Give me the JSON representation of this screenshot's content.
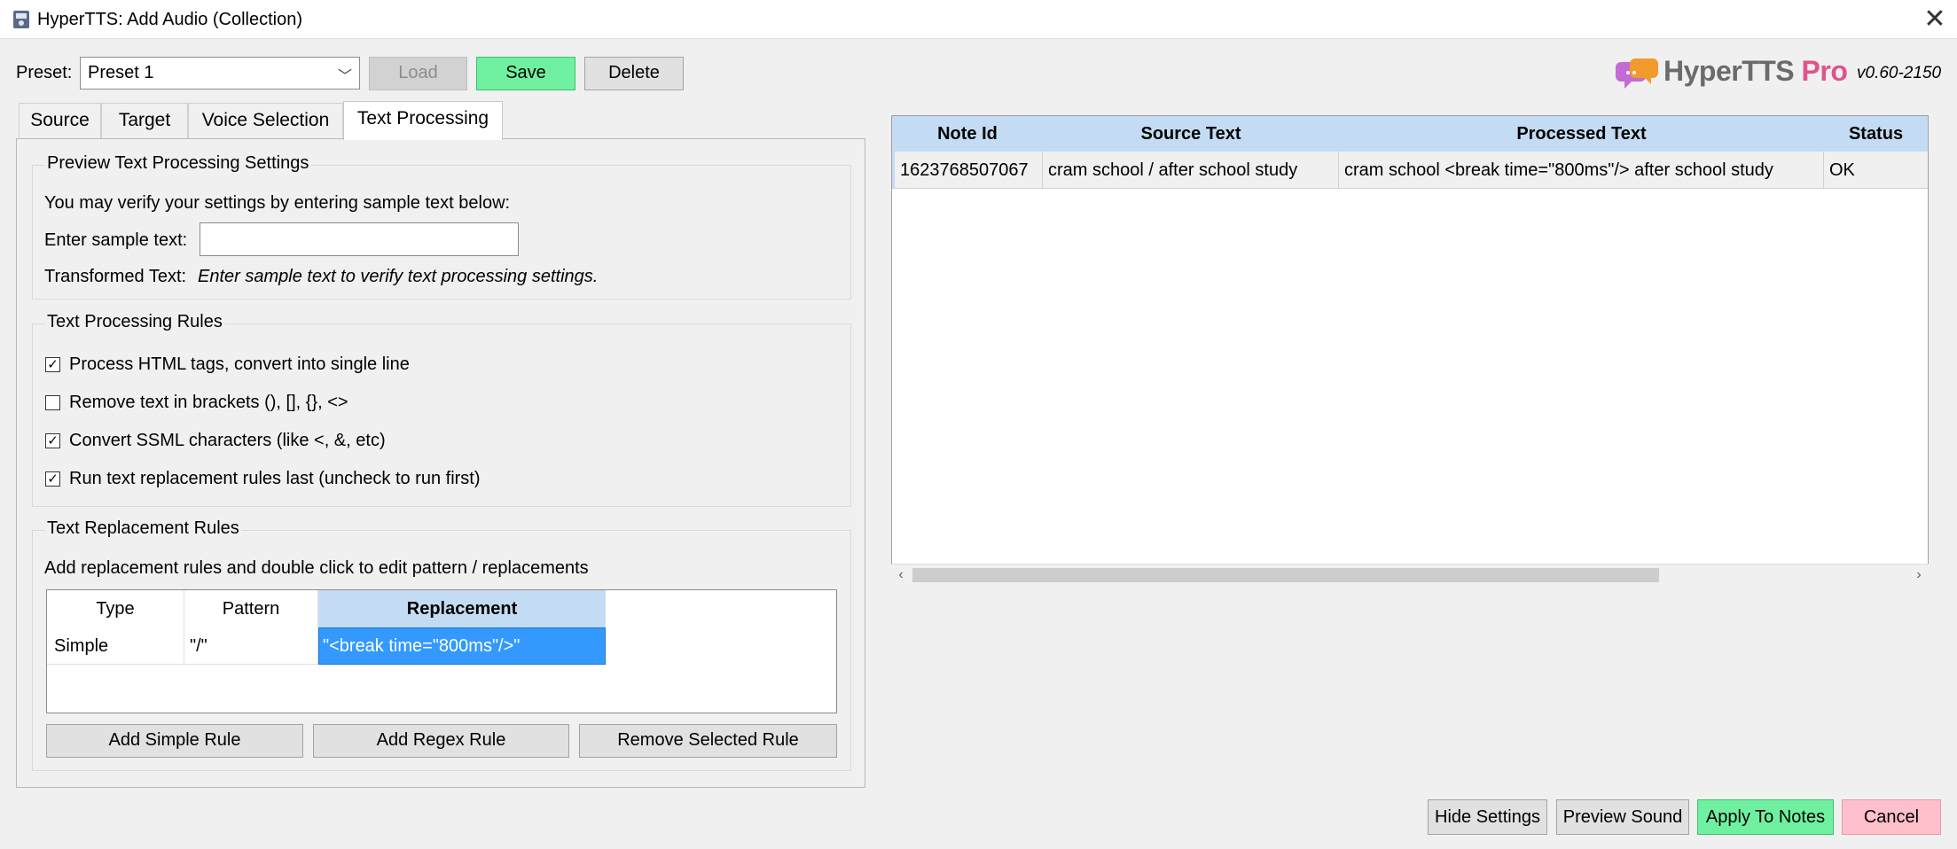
{
  "window": {
    "title": "HyperTTS: Add Audio (Collection)"
  },
  "preset": {
    "label": "Preset:",
    "selected": "Preset 1",
    "load_label": "Load",
    "save_label": "Save",
    "delete_label": "Delete"
  },
  "brand": {
    "name_main": "HyperTTS",
    "name_pro": "Pro",
    "version": "v0.60-2150"
  },
  "tabs": [
    {
      "label": "Source"
    },
    {
      "label": "Target"
    },
    {
      "label": "Voice Selection"
    },
    {
      "label": "Text Processing"
    }
  ],
  "preview": {
    "group_title": "Preview Text Processing Settings",
    "instructions": "You may verify your settings by entering sample text below:",
    "sample_label": "Enter sample text:",
    "sample_value": "",
    "transformed_label": "Transformed Text:",
    "transformed_value": "Enter sample text to verify text processing settings."
  },
  "rules": {
    "group_title": "Text Processing Rules",
    "items": [
      {
        "label": "Process HTML tags, convert into single line",
        "checked": true,
        "mark": "✓"
      },
      {
        "label": "Remove text in brackets (), [], {}, <>",
        "checked": false,
        "mark": ""
      },
      {
        "label": "Convert SSML characters (like <, &, etc)",
        "checked": true,
        "mark": "✓"
      },
      {
        "label": "Run text replacement rules last (uncheck to run first)",
        "checked": true,
        "mark": "✓"
      }
    ]
  },
  "replacement": {
    "group_title": "Text Replacement Rules",
    "instructions": "Add replacement rules and double click to edit pattern / replacements",
    "columns": [
      "Type",
      "Pattern",
      "Replacement"
    ],
    "rows": [
      {
        "type": "Simple",
        "pattern": "\"/\"",
        "replacement": "\"<break time=\"800ms\"/>\""
      }
    ],
    "add_simple_label": "Add Simple Rule",
    "add_regex_label": "Add Regex Rule",
    "remove_label": "Remove Selected Rule"
  },
  "preview_table": {
    "columns": [
      "Note Id",
      "Source Text",
      "Processed Text",
      "Status"
    ],
    "rows": [
      {
        "note_id": "1623768507067",
        "source_text": "cram school / after school study",
        "processed_text": "cram school <break time=\"800ms\"/> after school study",
        "status": "OK"
      }
    ]
  },
  "footer": {
    "hide_settings_label": "Hide Settings",
    "preview_sound_label": "Preview Sound",
    "apply_label": "Apply To Notes",
    "cancel_label": "Cancel"
  },
  "colors": {
    "save": "#6ff0a0",
    "apply": "#6ff0a0",
    "cancel": "#ffc0cb",
    "header_blue": "#c3dcf3",
    "selection": "#3399ff"
  }
}
